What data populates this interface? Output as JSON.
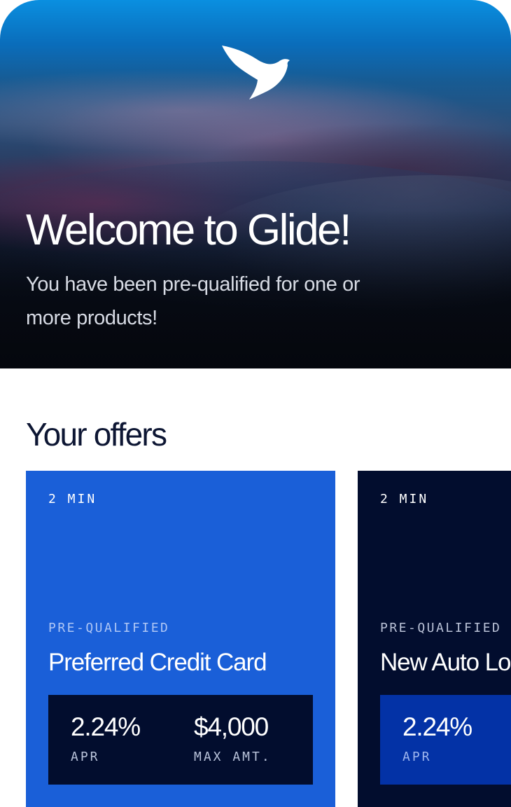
{
  "hero": {
    "title": "Welcome to Glide!",
    "subtitle": "You have been pre-qualified for one or more products!",
    "logo_icon": "bird-logo-icon"
  },
  "offers": {
    "section_title": "Your offers",
    "cards": [
      {
        "duration": "2 MIN",
        "status": "PRE-QUALIFIED",
        "name": "Preferred Credit Card",
        "stats": [
          {
            "value": "2.24%",
            "label": "APR"
          },
          {
            "value": "$4,000",
            "label": "MAX AMT."
          }
        ],
        "card_color": "#1a5fd8",
        "stats_color": "#020d2e"
      },
      {
        "duration": "2 MIN",
        "status": "PRE-QUALIFIED",
        "name": "New Auto Lo",
        "stats": [
          {
            "value": "2.24%",
            "label": "APR"
          }
        ],
        "card_color": "#020d2e",
        "stats_color": "#0332a6"
      }
    ]
  }
}
